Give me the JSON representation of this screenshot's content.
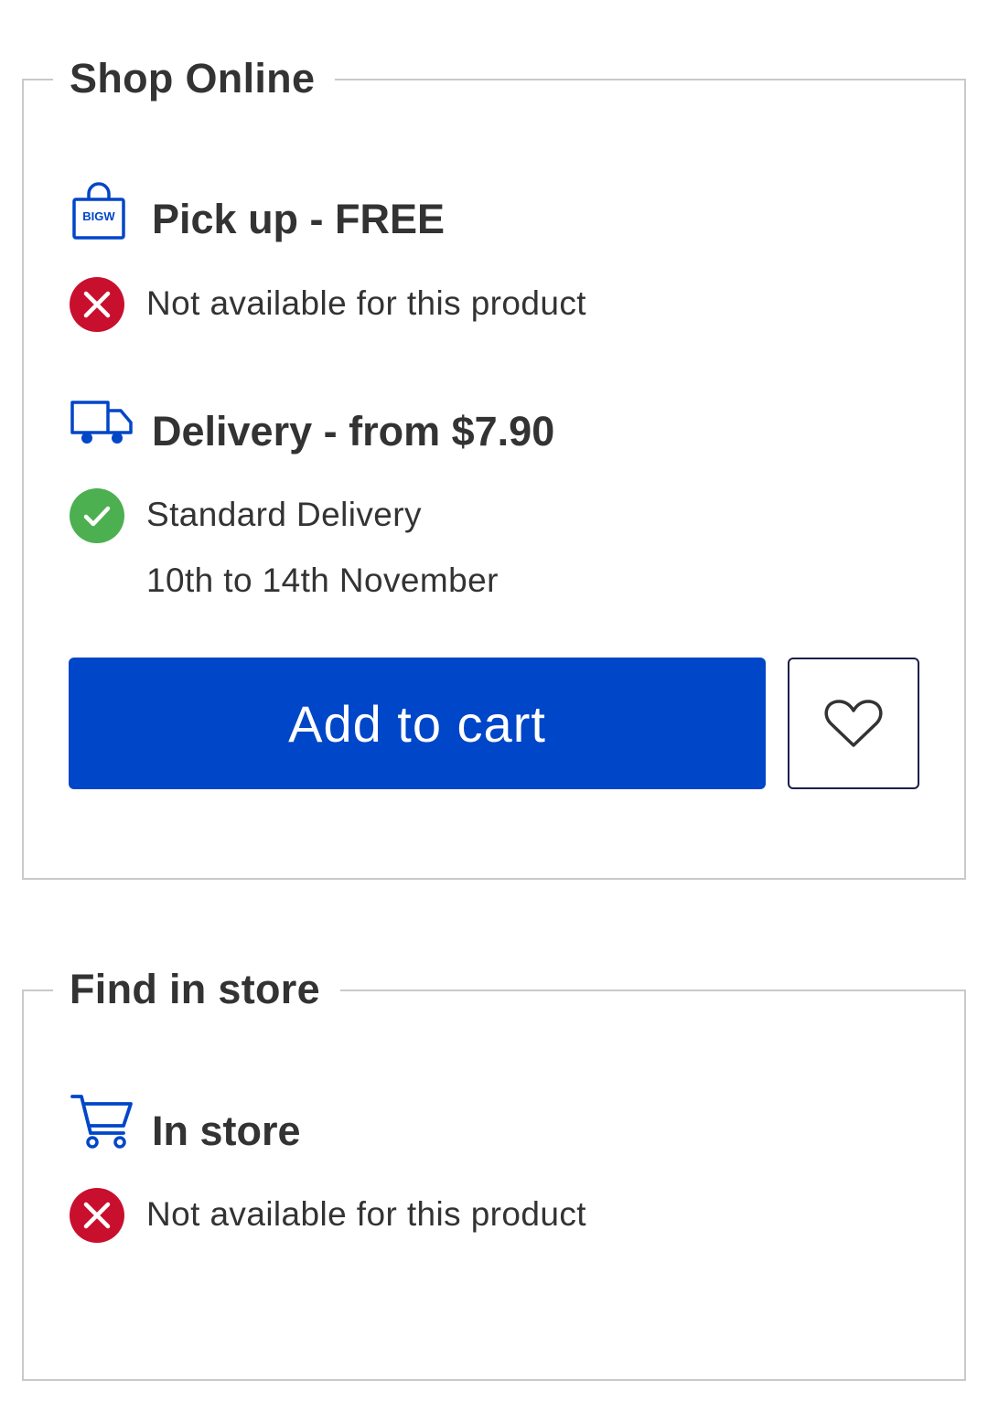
{
  "shop_online": {
    "title": "Shop Online",
    "pickup": {
      "heading": "Pick up - FREE",
      "icon": "shopping-bag-icon",
      "icon_text": "BIGW",
      "status_icon": "cross-circle-icon",
      "status_text": "Not available for this product"
    },
    "delivery": {
      "heading": "Delivery - from $7.90",
      "icon": "delivery-truck-icon",
      "status_icon": "check-circle-icon",
      "method": "Standard Delivery",
      "dates": "10th to 14th November"
    },
    "add_to_cart_label": "Add to cart",
    "wishlist_icon": "heart-icon"
  },
  "find_in_store": {
    "title": "Find in store",
    "in_store": {
      "heading": "In store",
      "icon": "shopping-cart-icon",
      "status_icon": "cross-circle-icon",
      "status_text": "Not available for this product"
    }
  },
  "colors": {
    "brand_blue": "#0046c8",
    "error_red": "#c8102e",
    "success_green": "#4caf50",
    "text": "#333333",
    "border": "#c9c9c9"
  }
}
